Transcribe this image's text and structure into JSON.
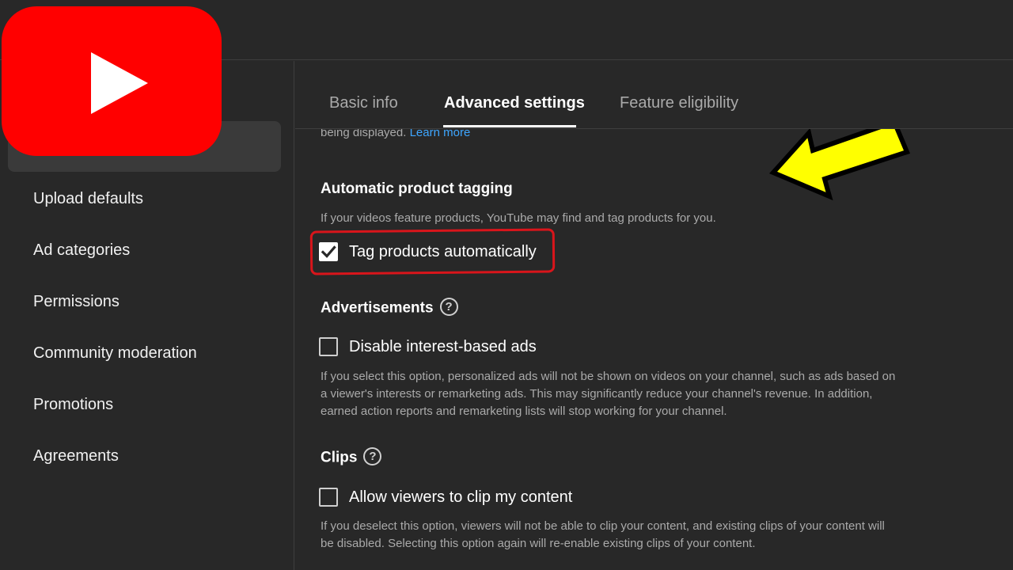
{
  "sidebar": {
    "items": [
      {
        "label": "Upload defaults"
      },
      {
        "label": "Ad categories"
      },
      {
        "label": "Permissions"
      },
      {
        "label": "Community moderation"
      },
      {
        "label": "Promotions"
      },
      {
        "label": "Agreements"
      }
    ]
  },
  "tabs": [
    {
      "label": "Basic info"
    },
    {
      "label": "Advanced settings"
    },
    {
      "label": "Feature eligibility"
    }
  ],
  "content": {
    "cut_text": "being displayed.",
    "learn_more": "Learn more",
    "product_tagging": {
      "title": "Automatic product tagging",
      "description": "If your videos feature products, YouTube may find and tag products for you.",
      "checkbox_label": "Tag products automatically"
    },
    "advertisements": {
      "title": "Advertisements",
      "checkbox_label": "Disable interest-based ads",
      "description_lines": [
        "If you select this option, personalized ads will not be shown on videos on your channel, such as ads based on",
        "a viewer's interests or remarketing ads. This may significantly reduce your channel's revenue. In addition,",
        "earned action reports and remarketing lists will stop working for your channel."
      ]
    },
    "clips": {
      "title": "Clips",
      "checkbox_label": "Allow viewers to clip my content",
      "description_lines": [
        "If you deselect this option, viewers will not be able to clip your content, and existing clips of your content will",
        "be disabled. Selecting this option again will re-enable existing clips of your content."
      ]
    }
  },
  "icons": {
    "help": "?",
    "logo": "youtube-logo-icon",
    "arrow": "yellow-arrow-icon"
  },
  "colors": {
    "background": "#282828",
    "link": "#3ea6ff",
    "logo_red": "#ff0000",
    "highlight_outline": "#d9151b",
    "arrow_yellow": "#ffff00"
  }
}
